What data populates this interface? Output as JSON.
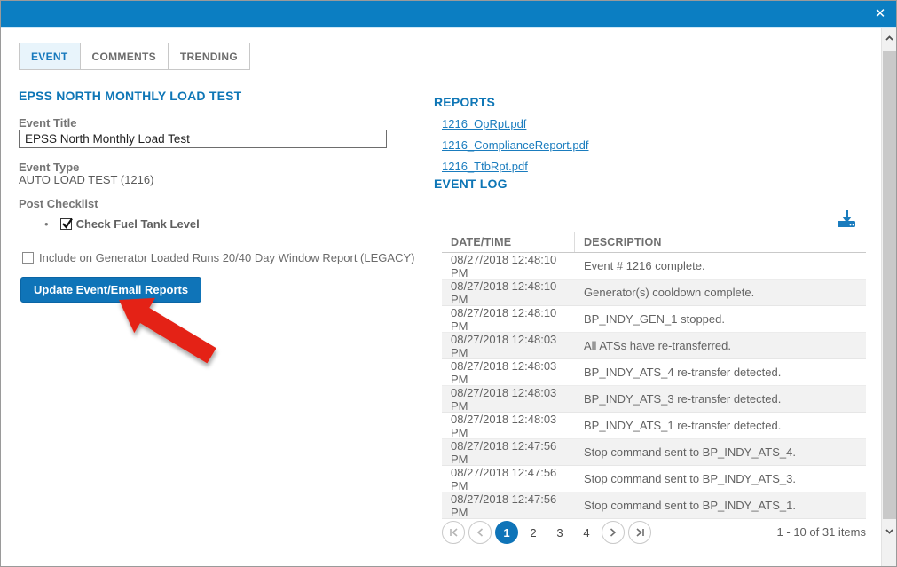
{
  "window": {
    "close_icon": "✕",
    "colors": {
      "titlebar": "#0b7ec2",
      "accent_blue": "#0f74b8",
      "heading_blue": "#0e76b6",
      "link_blue": "#1a7cbe",
      "arrow_red": "#e42313"
    }
  },
  "tabs": [
    {
      "label": "EVENT",
      "active": true
    },
    {
      "label": "COMMENTS",
      "active": false
    },
    {
      "label": "TRENDING",
      "active": false
    }
  ],
  "event_form": {
    "section_title": "EPSS NORTH MONTHLY LOAD TEST",
    "event_title_label": "Event Title",
    "event_title_value": "EPSS North Monthly Load Test",
    "event_type_label": "Event Type",
    "event_type_value": "AUTO LOAD TEST (1216)",
    "post_checklist_label": "Post Checklist",
    "bullet": "•",
    "checklist_items": [
      {
        "label": "Check Fuel Tank Level",
        "checked": true
      }
    ],
    "legacy_checkbox_label": "Include on Generator Loaded Runs 20/40 Day Window Report (LEGACY)",
    "legacy_checkbox_checked": false,
    "update_button_label": "Update Event/Email Reports"
  },
  "reports": {
    "title": "REPORTS",
    "links": [
      "1216_OpRpt.pdf",
      "1216_ComplianceReport.pdf",
      "1216_TtbRpt.pdf"
    ]
  },
  "event_log": {
    "title": "EVENT LOG",
    "columns": [
      "DATE/TIME",
      "DESCRIPTION"
    ],
    "rows": [
      {
        "datetime": "08/27/2018 12:48:10 PM",
        "description": "Event # 1216 complete."
      },
      {
        "datetime": "08/27/2018 12:48:10 PM",
        "description": "Generator(s) cooldown complete."
      },
      {
        "datetime": "08/27/2018 12:48:10 PM",
        "description": "BP_INDY_GEN_1 stopped."
      },
      {
        "datetime": "08/27/2018 12:48:03 PM",
        "description": "All ATSs have re-transferred."
      },
      {
        "datetime": "08/27/2018 12:48:03 PM",
        "description": "BP_INDY_ATS_4 re-transfer detected."
      },
      {
        "datetime": "08/27/2018 12:48:03 PM",
        "description": "BP_INDY_ATS_3 re-transfer detected."
      },
      {
        "datetime": "08/27/2018 12:48:03 PM",
        "description": "BP_INDY_ATS_1 re-transfer detected."
      },
      {
        "datetime": "08/27/2018 12:47:56 PM",
        "description": "Stop command sent to BP_INDY_ATS_4."
      },
      {
        "datetime": "08/27/2018 12:47:56 PM",
        "description": "Stop command sent to BP_INDY_ATS_3."
      },
      {
        "datetime": "08/27/2018 12:47:56 PM",
        "description": "Stop command sent to BP_INDY_ATS_1."
      }
    ],
    "pager": {
      "pages": [
        "1",
        "2",
        "3",
        "4"
      ],
      "current_page": "1",
      "summary": "1 - 10 of 31 items"
    }
  }
}
